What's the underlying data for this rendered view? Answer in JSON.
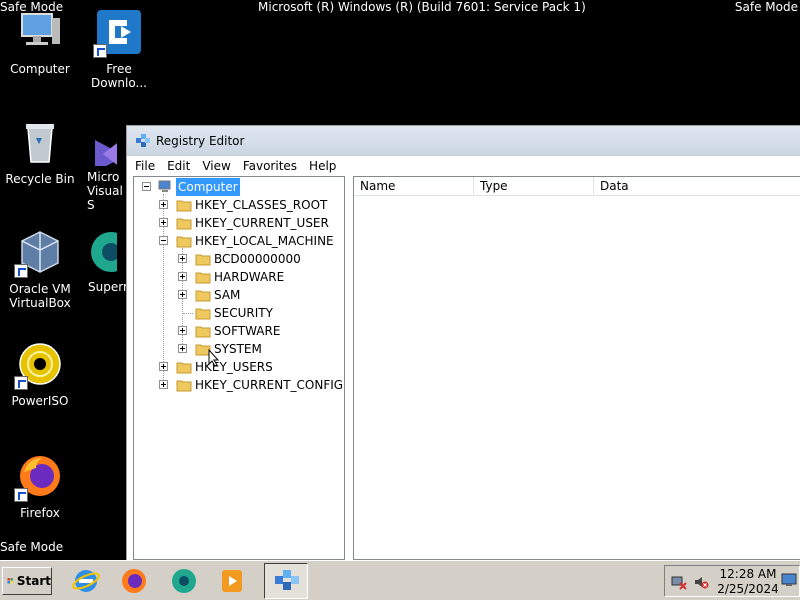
{
  "desktop": {
    "safe_mode_label": "Safe Mode",
    "build_text": "Microsoft (R) Windows (R) (Build 7601: Service Pack 1)",
    "icons": [
      {
        "label": "Computer"
      },
      {
        "label": "Free Downlo..."
      },
      {
        "label": "Recycle Bin"
      },
      {
        "label": "Micro Visual S"
      },
      {
        "label": "Oracle VM VirtualBox"
      },
      {
        "label": "Superm"
      },
      {
        "label": "PowerISO"
      },
      {
        "label": "Firefox"
      }
    ]
  },
  "regedit": {
    "title": "Registry Editor",
    "menu": [
      "File",
      "Edit",
      "View",
      "Favorites",
      "Help"
    ],
    "columns": [
      "Name",
      "Type",
      "Data"
    ],
    "tree": {
      "root": "Computer",
      "hives": [
        "HKEY_CLASSES_ROOT",
        "HKEY_CURRENT_USER",
        "HKEY_LOCAL_MACHINE",
        "HKEY_USERS",
        "HKEY_CURRENT_CONFIG"
      ],
      "hklm_children": [
        "BCD00000000",
        "HARDWARE",
        "SAM",
        "SECURITY",
        "SOFTWARE",
        "SYSTEM"
      ]
    }
  },
  "taskbar": {
    "start_label": "Start",
    "apps": [
      "internet-explorer-icon",
      "firefox-icon",
      "supermium-icon",
      "media-player-icon",
      "registry-editor-icon"
    ],
    "time": "12:28 AM",
    "date": "2/25/2024"
  }
}
